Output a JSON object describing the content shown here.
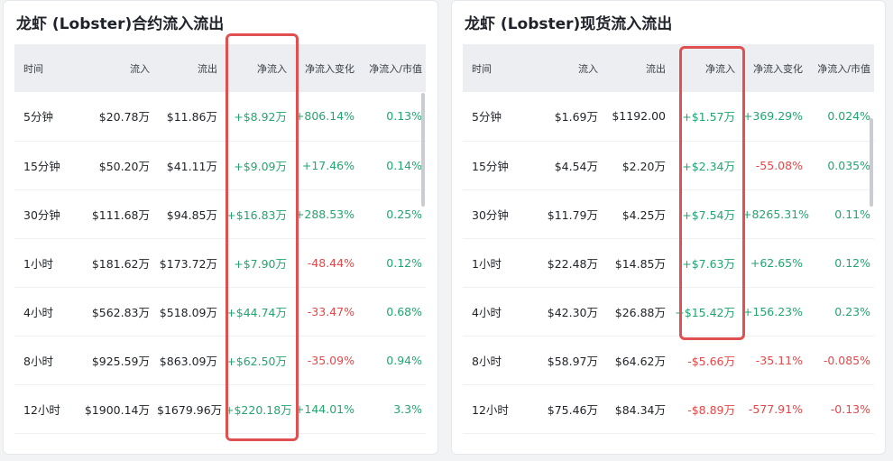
{
  "colors": {
    "positive": "#22a66f",
    "negative": "#e54848",
    "highlight": "#e05050"
  },
  "panels": [
    {
      "title": "龙虾 (Lobster)合约流入流出",
      "columns": [
        "时间",
        "流入",
        "流出",
        "净流入",
        "净流入变化",
        "净流入/市值"
      ],
      "rows": [
        {
          "time": "5分钟",
          "inflow": "$20.78万",
          "outflow": "$11.86万",
          "net": "+$8.92万",
          "change": "+806.14%",
          "ratio": "0.13%"
        },
        {
          "time": "15分钟",
          "inflow": "$50.20万",
          "outflow": "$41.11万",
          "net": "+$9.09万",
          "change": "+17.46%",
          "ratio": "0.14%"
        },
        {
          "time": "30分钟",
          "inflow": "$111.68万",
          "outflow": "$94.85万",
          "net": "+$16.83万",
          "change": "+288.53%",
          "ratio": "0.25%"
        },
        {
          "time": "1小时",
          "inflow": "$181.62万",
          "outflow": "$173.72万",
          "net": "+$7.90万",
          "change": "-48.44%",
          "ratio": "0.12%"
        },
        {
          "time": "4小时",
          "inflow": "$562.83万",
          "outflow": "$518.09万",
          "net": "+$44.74万",
          "change": "-33.47%",
          "ratio": "0.68%"
        },
        {
          "time": "8小时",
          "inflow": "$925.59万",
          "outflow": "$863.09万",
          "net": "+$62.50万",
          "change": "-35.09%",
          "ratio": "0.94%"
        },
        {
          "time": "12小时",
          "inflow": "$1900.14万",
          "outflow": "$1679.96万",
          "net": "+$220.18万",
          "change": "+144.01%",
          "ratio": "3.3%"
        }
      ]
    },
    {
      "title": "龙虾 (Lobster)现货流入流出",
      "columns": [
        "时间",
        "流入",
        "流出",
        "净流入",
        "净流入变化",
        "净流入/市值"
      ],
      "rows": [
        {
          "time": "5分钟",
          "inflow": "$1.69万",
          "outflow": "$1192.00",
          "net": "+$1.57万",
          "change": "+369.29%",
          "ratio": "0.024%"
        },
        {
          "time": "15分钟",
          "inflow": "$4.54万",
          "outflow": "$2.20万",
          "net": "+$2.34万",
          "change": "-55.08%",
          "ratio": "0.035%"
        },
        {
          "time": "30分钟",
          "inflow": "$11.79万",
          "outflow": "$4.25万",
          "net": "+$7.54万",
          "change": "+8265.31%",
          "ratio": "0.11%"
        },
        {
          "time": "1小时",
          "inflow": "$22.48万",
          "outflow": "$14.85万",
          "net": "+$7.63万",
          "change": "+62.65%",
          "ratio": "0.12%"
        },
        {
          "time": "4小时",
          "inflow": "$42.30万",
          "outflow": "$26.88万",
          "net": "+$15.42万",
          "change": "+156.23%",
          "ratio": "0.23%"
        },
        {
          "time": "8小时",
          "inflow": "$58.97万",
          "outflow": "$64.62万",
          "net": "-$5.66万",
          "change": "-35.11%",
          "ratio": "-0.085%"
        },
        {
          "time": "12小时",
          "inflow": "$75.46万",
          "outflow": "$84.34万",
          "net": "-$8.89万",
          "change": "-577.91%",
          "ratio": "-0.13%"
        }
      ]
    }
  ]
}
